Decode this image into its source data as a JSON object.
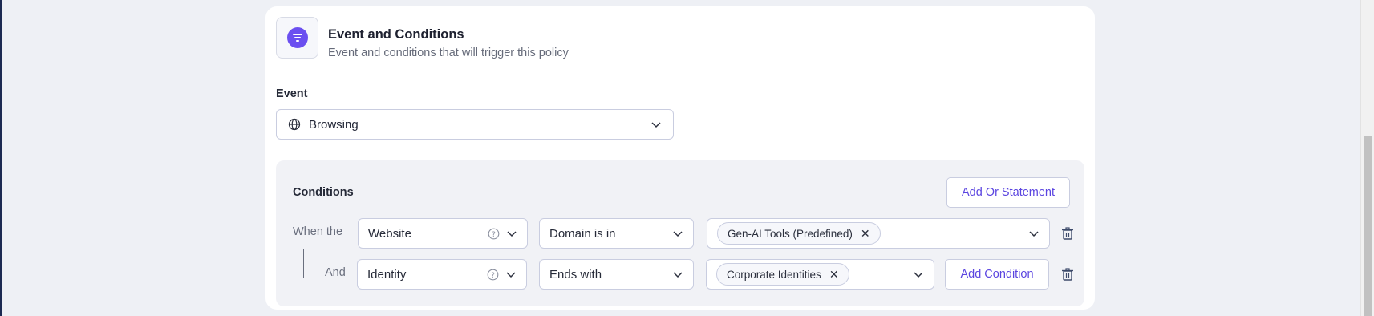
{
  "header": {
    "title": "Event and Conditions",
    "subtitle": "Event and conditions that will trigger this policy"
  },
  "event": {
    "label": "Event",
    "value": "Browsing"
  },
  "conditions": {
    "title": "Conditions",
    "add_or_label": "Add Or Statement",
    "add_condition_label": "Add Condition",
    "rows": [
      {
        "prefix": "When the",
        "field": "Website",
        "operator": "Domain is in",
        "chips": [
          "Gen-AI Tools (Predefined)"
        ]
      },
      {
        "prefix": "And",
        "field": "Identity",
        "operator": "Ends with",
        "chips": [
          "Corporate Identities"
        ]
      }
    ]
  },
  "colors": {
    "accent": "#5b45e0",
    "icon_bg": "#6b4ff0"
  }
}
